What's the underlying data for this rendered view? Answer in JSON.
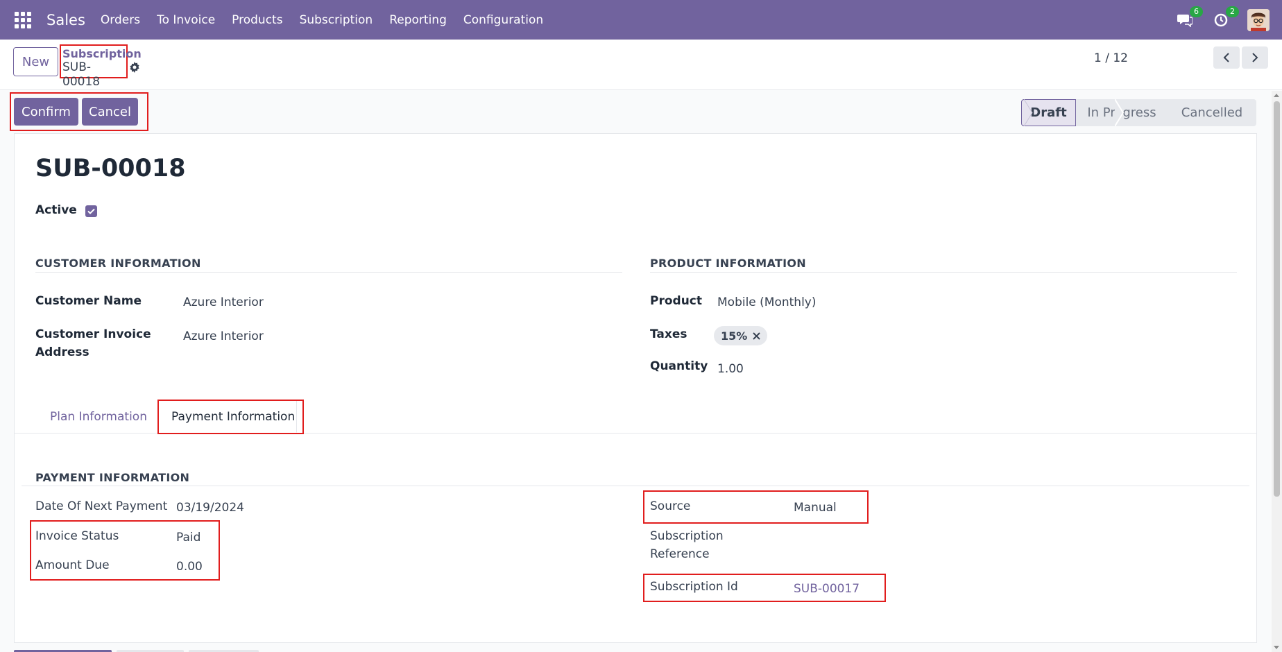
{
  "navbar": {
    "app_name": "Sales",
    "menu": [
      "Orders",
      "To Invoice",
      "Products",
      "Subscription",
      "Reporting",
      "Configuration"
    ],
    "messages_count": "6",
    "activities_count": "2"
  },
  "control_panel": {
    "new_label": "New",
    "breadcrumb_parent": "Subscription",
    "breadcrumb_current": "SUB-00018",
    "pager": "1 / 12"
  },
  "actions": {
    "confirm_label": "Confirm",
    "cancel_label": "Cancel"
  },
  "status": {
    "stages": [
      "Draft",
      "In Progress",
      "Cancelled"
    ],
    "active": "Draft"
  },
  "form": {
    "title": "SUB-00018",
    "active_label": "Active",
    "active_checked": true,
    "customer_section": "CUSTOMER INFORMATION",
    "customer_name_label": "Customer Name",
    "customer_name": "Azure Interior",
    "invoice_address_label_1": "Customer Invoice",
    "invoice_address_label_2": "Address",
    "invoice_address": "Azure Interior",
    "product_section": "PRODUCT INFORMATION",
    "product_label": "Product",
    "product": "Mobile (Monthly)",
    "taxes_label": "Taxes",
    "tax_tag": "15%",
    "quantity_label": "Quantity",
    "quantity": "1.00"
  },
  "tabs": {
    "plan": "Plan Information",
    "payment": "Payment Information",
    "active": "Payment Information"
  },
  "payment": {
    "section": "PAYMENT INFORMATION",
    "next_payment_label": "Date Of Next Payment",
    "next_payment": "03/19/2024",
    "invoice_status_label": "Invoice Status",
    "invoice_status": "Paid",
    "amount_due_label": "Amount Due",
    "amount_due": "0.00",
    "source_label": "Source",
    "source": "Manual",
    "sub_ref_label_1": "Subscription",
    "sub_ref_label_2": "Reference",
    "sub_id_label": "Subscription Id",
    "sub_id": "SUB-00017"
  },
  "colors": {
    "brand": "#71639e",
    "highlight": "#e11d1d"
  }
}
